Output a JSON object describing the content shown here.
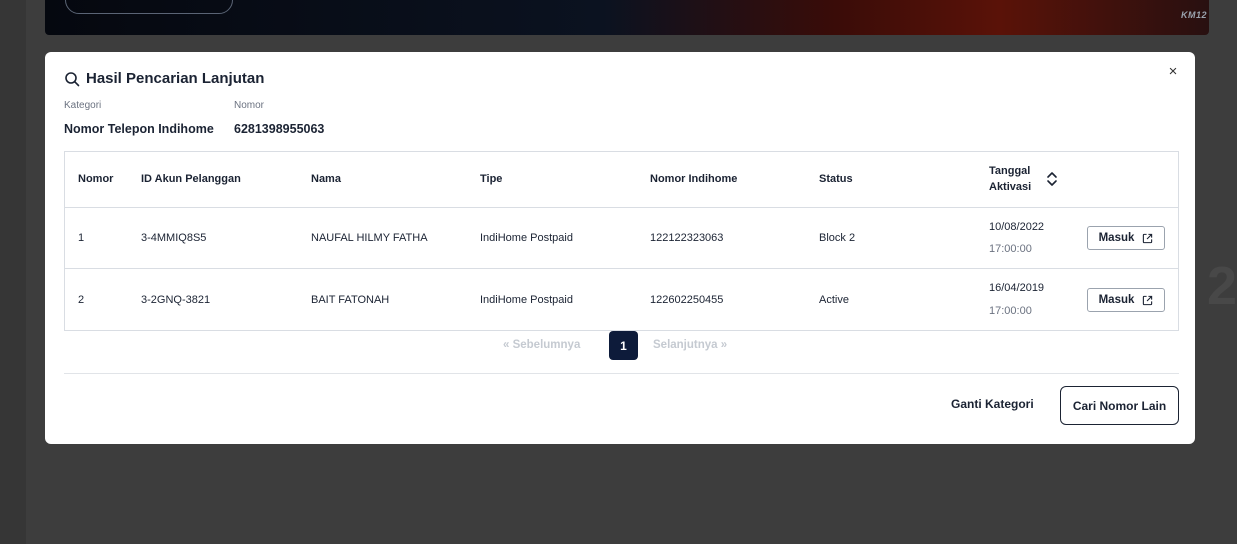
{
  "background": {
    "banner_tag": "KM12",
    "ghost_text": "2"
  },
  "modal": {
    "title": "Hasil Pencarian Lanjutan",
    "close_glyph": "×",
    "category_label": "Kategori",
    "category_value": "Nomor Telepon Indihome",
    "number_label": "Nomor",
    "number_value": "6281398955063"
  },
  "table": {
    "headers": {
      "nomor": "Nomor",
      "id_akun": "ID Akun Pelanggan",
      "nama": "Nama",
      "tipe": "Tipe",
      "nomor_indihome": "Nomor Indihome",
      "status": "Status",
      "tanggal_line1": "Tanggal",
      "tanggal_line2": "Aktivasi"
    },
    "rows": [
      {
        "nomor": "1",
        "id_akun": "3-4MMIQ8S5",
        "nama": "NAUFAL HILMY FATHA",
        "tipe": "IndiHome Postpaid",
        "nomor_indihome": "122122323063",
        "status": "Block 2",
        "date": "10/08/2022",
        "time": "17:00:00",
        "action": "Masuk"
      },
      {
        "nomor": "2",
        "id_akun": "3-2GNQ-3821",
        "nama": "BAIT FATONAH",
        "tipe": "IndiHome Postpaid",
        "nomor_indihome": "122602250455",
        "status": "Active",
        "date": "16/04/2019",
        "time": "17:00:00",
        "action": "Masuk"
      }
    ]
  },
  "pagination": {
    "prev_label": "«  Sebelumnya",
    "current_page": "1",
    "next_label": "Selanjutnya  »"
  },
  "footer": {
    "change_category": "Ganti Kategori",
    "search_other": "Cari Nomor Lain"
  },
  "colors": {
    "primary": "#0d1b3a",
    "text": "#1b2333",
    "border": "#d9dde3",
    "disabled": "#c5cad1"
  }
}
